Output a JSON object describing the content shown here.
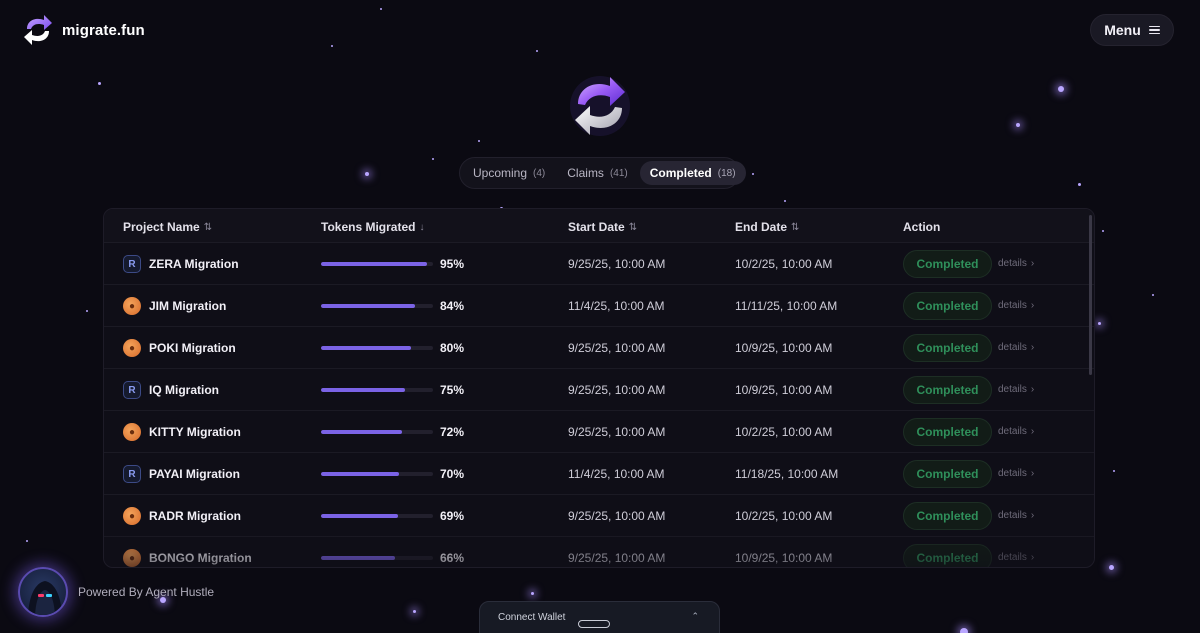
{
  "brand": {
    "name": "migrate.fun"
  },
  "header": {
    "menu_label": "Menu"
  },
  "tabs": [
    {
      "label": "Upcoming",
      "count": "(4)",
      "active": false
    },
    {
      "label": "Claims",
      "count": "(41)",
      "active": false
    },
    {
      "label": "Completed",
      "count": "(18)",
      "active": true
    }
  ],
  "table": {
    "columns": {
      "project": "Project Name",
      "tokens": "Tokens Migrated",
      "start": "Start Date",
      "end": "End Date",
      "action": "Action"
    },
    "sort_icons": {
      "project": "⇅",
      "tokens": "↓",
      "start": "⇅",
      "end": "⇅"
    },
    "rows": [
      {
        "name": "ZERA Migration",
        "icon": "raydium-icon",
        "progress": 0.95,
        "percent": "95%",
        "start": "9/25/25, 10:00 AM",
        "end": "10/2/25, 10:00 AM",
        "status": "Completed",
        "details": "details"
      },
      {
        "name": "JIM Migration",
        "icon": "pump-icon",
        "progress": 0.84,
        "percent": "84%",
        "start": "11/4/25, 10:00 AM",
        "end": "11/11/25, 10:00 AM",
        "status": "Completed",
        "details": "details"
      },
      {
        "name": "POKI Migration",
        "icon": "pump-icon",
        "progress": 0.8,
        "percent": "80%",
        "start": "9/25/25, 10:00 AM",
        "end": "10/9/25, 10:00 AM",
        "status": "Completed",
        "details": "details"
      },
      {
        "name": "IQ Migration",
        "icon": "raydium-icon",
        "progress": 0.75,
        "percent": "75%",
        "start": "9/25/25, 10:00 AM",
        "end": "10/9/25, 10:00 AM",
        "status": "Completed",
        "details": "details"
      },
      {
        "name": "KITTY Migration",
        "icon": "pump-icon",
        "progress": 0.72,
        "percent": "72%",
        "start": "9/25/25, 10:00 AM",
        "end": "10/2/25, 10:00 AM",
        "status": "Completed",
        "details": "details"
      },
      {
        "name": "PAYAI Migration",
        "icon": "raydium-icon",
        "progress": 0.7,
        "percent": "70%",
        "start": "11/4/25, 10:00 AM",
        "end": "11/18/25, 10:00 AM",
        "status": "Completed",
        "details": "details"
      },
      {
        "name": "RADR Migration",
        "icon": "pump-icon",
        "progress": 0.69,
        "percent": "69%",
        "start": "9/25/25, 10:00 AM",
        "end": "10/2/25, 10:00 AM",
        "status": "Completed",
        "details": "details"
      },
      {
        "name": "BONGO Migration",
        "icon": "pump-icon",
        "progress": 0.66,
        "percent": "66%",
        "start": "9/25/25, 10:00 AM",
        "end": "10/9/25, 10:00 AM",
        "status": "Completed",
        "details": "details"
      }
    ]
  },
  "footer": {
    "powered_by": "Powered By Agent Hustle",
    "wallet_label": "Connect Wallet"
  },
  "colors": {
    "accent": "#7b63e6",
    "completed_text": "#2f8f5a",
    "background": "#0b0a12"
  }
}
